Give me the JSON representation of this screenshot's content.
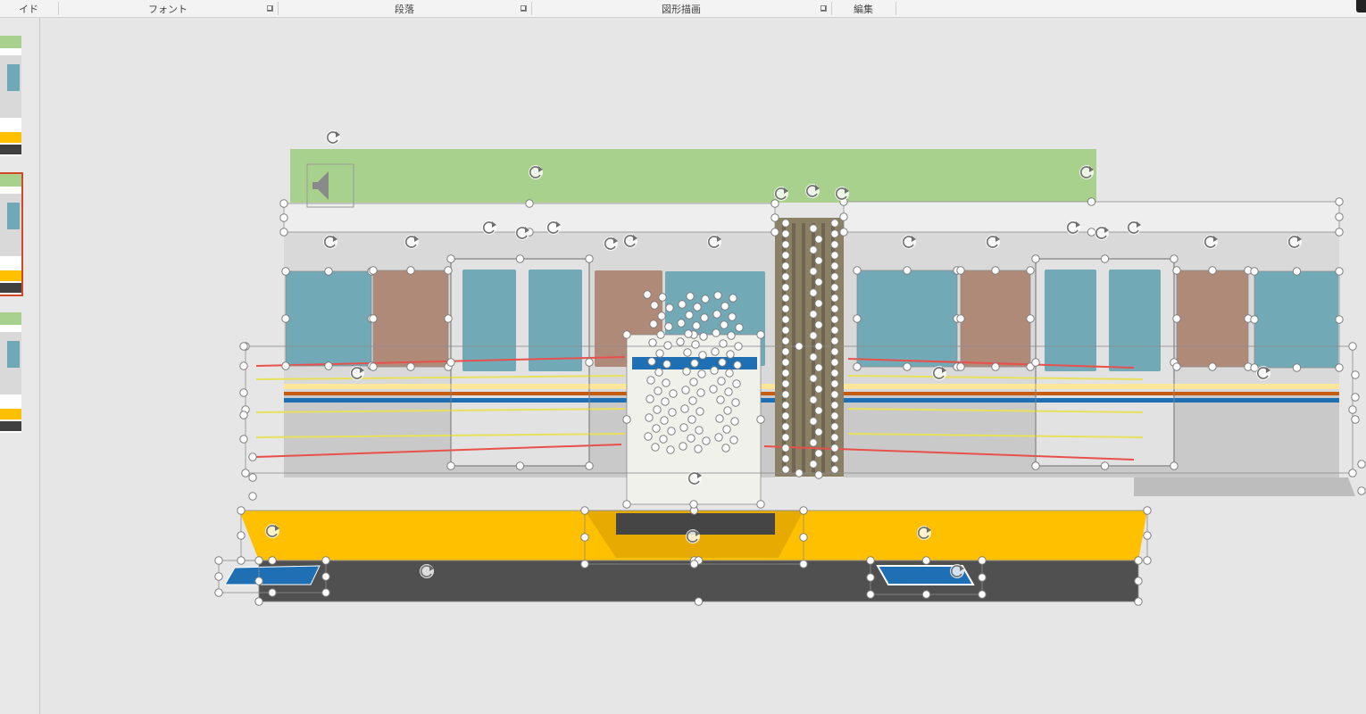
{
  "ribbon": {
    "groups": [
      {
        "label": "イド",
        "has_launcher": false
      },
      {
        "label": "フォント",
        "has_launcher": true
      },
      {
        "label": "段落",
        "has_launcher": true
      },
      {
        "label": "図形描画",
        "has_launcher": true
      },
      {
        "label": "編集",
        "has_launcher": false
      }
    ]
  },
  "thumbnails": [
    {
      "name": "slide-thumb-1",
      "selected": false
    },
    {
      "name": "slide-thumb-2",
      "selected": true
    },
    {
      "name": "slide-thumb-3",
      "selected": false
    }
  ],
  "slide": {
    "colors": {
      "roof_band": "#a9d18e",
      "car_body": "#d9d9d9",
      "car_body_light": "#eeeeee",
      "window_glass": "#72a9b7",
      "window_panel": "#b08a78",
      "stripe_blue": "#1f6fb5",
      "stripe_orange": "#c55a11",
      "stripe_yellow": "#ffe699",
      "platform_yellow": "#ffc000",
      "platform_dark": "#505050",
      "line_red": "#e8514b",
      "line_yellow": "#e8e05a",
      "handle": "#ffffff"
    },
    "icons": [
      "speaker-icon",
      "rotate-handle-icon"
    ]
  }
}
